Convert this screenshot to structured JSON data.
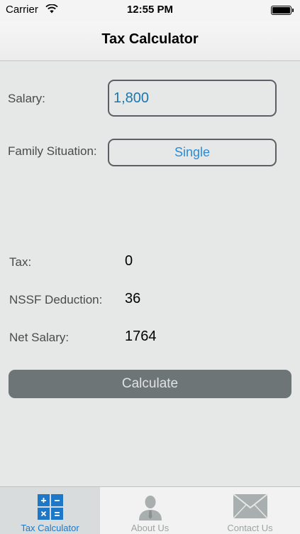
{
  "status_bar": {
    "carrier": "Carrier",
    "time": "12:55 PM"
  },
  "nav": {
    "title": "Tax Calculator"
  },
  "form": {
    "salary_label": "Salary:",
    "salary_value": "1,800",
    "family_label": "Family Situation:",
    "family_value": "Single"
  },
  "results": {
    "tax_label": "Tax:",
    "tax_value": "0",
    "nssf_label": "NSSF Deduction:",
    "nssf_value": "36",
    "net_label": "Net Salary:",
    "net_value": "1764"
  },
  "calculate_label": "Calculate",
  "tabs": [
    {
      "label": "Tax Calculator",
      "icon": "calculator-icon",
      "active": true
    },
    {
      "label": "About Us",
      "icon": "person-icon",
      "active": false
    },
    {
      "label": "Contact Us",
      "icon": "envelope-icon",
      "active": false
    }
  ],
  "colors": {
    "accent": "#1d78c7",
    "button": "#6e7576",
    "background": "#e6e8e8"
  }
}
